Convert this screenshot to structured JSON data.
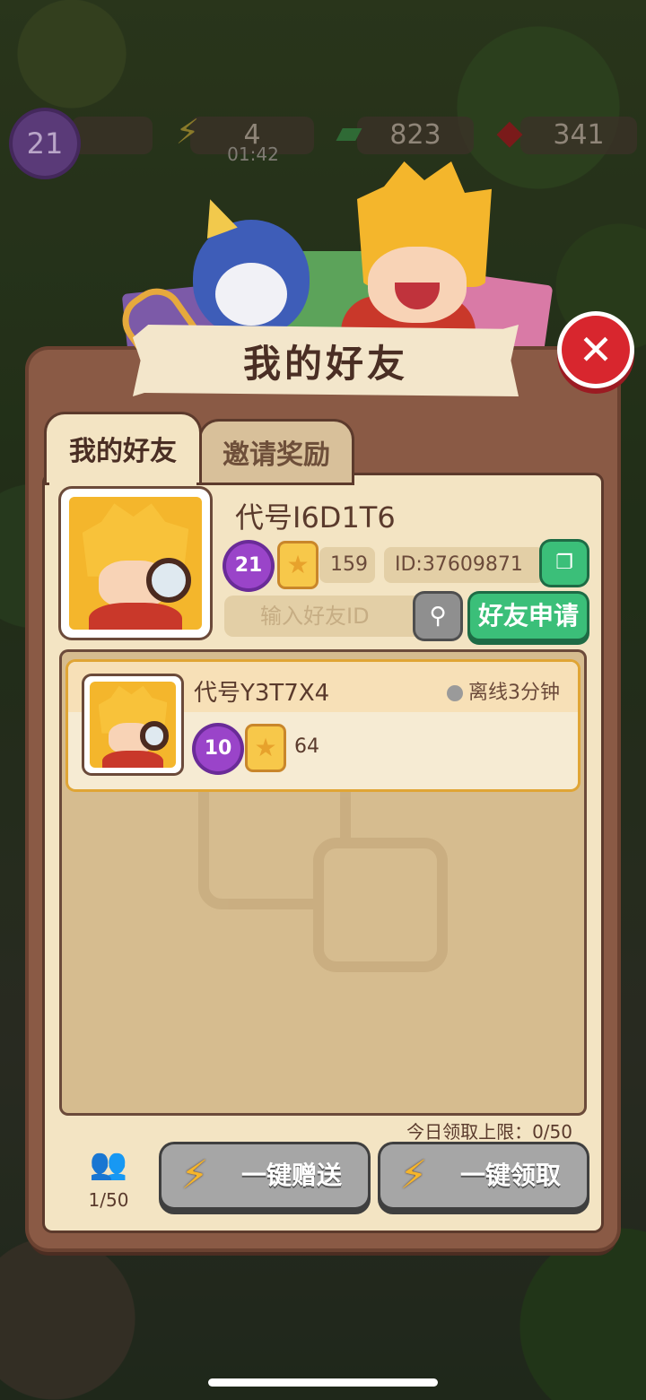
{
  "hud": {
    "level": "21",
    "energy": "4",
    "energy_timer": "01:42",
    "cash": "823",
    "gems": "341",
    "energy_icon": "lightning-icon",
    "cash_icon": "cash-icon",
    "gem_icon": "ruby-icon"
  },
  "dialog": {
    "title": "我的好友",
    "close_icon": "close-icon"
  },
  "tabs": [
    {
      "label": "我的好友",
      "active": true
    },
    {
      "label": "邀请奖励",
      "active": false
    }
  ],
  "profile": {
    "nickname": "代号I6D1T6",
    "level": "21",
    "stars": "159",
    "id_text": "ID:37609871",
    "search_placeholder": "输入好友ID",
    "apply_label": "好友申请"
  },
  "friends": [
    {
      "name": "代号Y3T7X4",
      "status": "离线3分钟",
      "level": "10",
      "stars": "64"
    }
  ],
  "footer": {
    "daily_limit": "今日领取上限：0/50",
    "friend_count": "1/50",
    "send_all_label": "一键赠送",
    "claim_all_label": "一键领取"
  },
  "colors": {
    "panel": "#8a5a45",
    "panel_inner": "#f3e4c3",
    "accent_green": "#3bbf79",
    "close_red": "#d8262e",
    "level_purple": "#9a44c9",
    "star_yellow": "#f7c84a"
  }
}
